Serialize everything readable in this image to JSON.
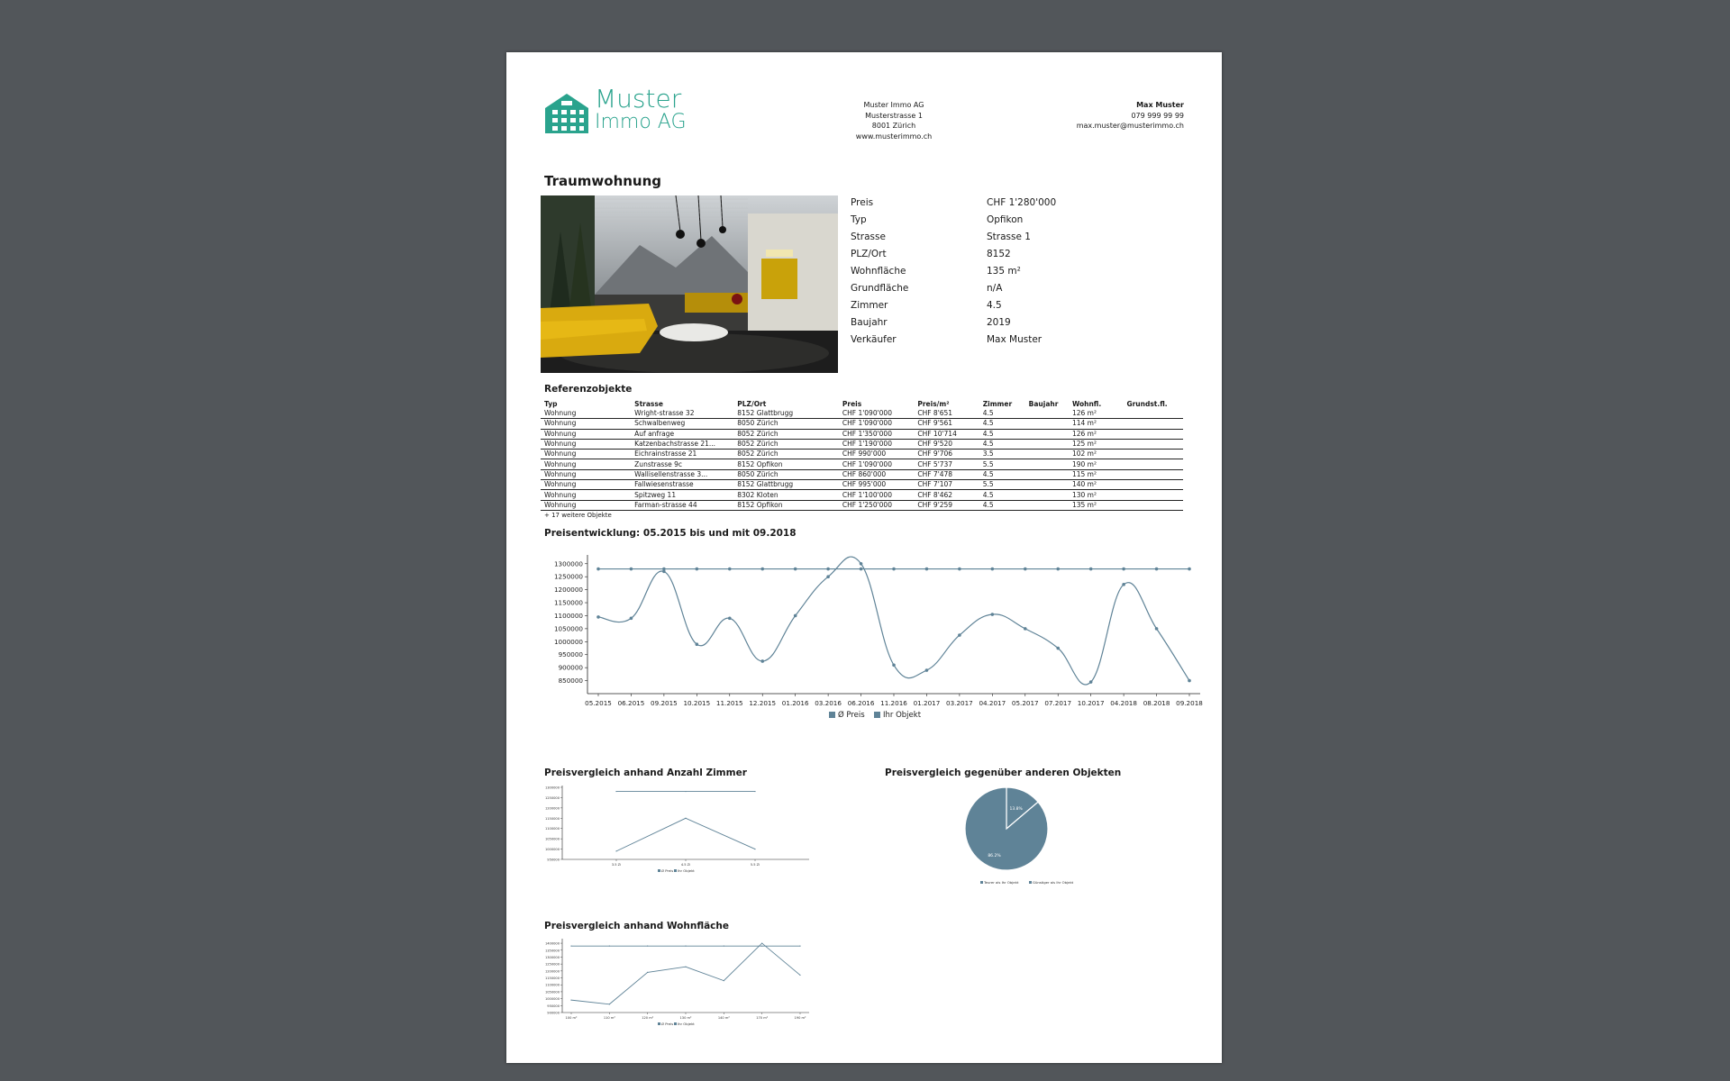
{
  "header": {
    "logo": {
      "line1": "Muster",
      "line2": "Immo AG"
    },
    "company": [
      "Muster Immo AG",
      "Musterstrasse 1",
      "8001 Zürich",
      "www.musterimmo.ch"
    ],
    "contact": {
      "name": "Max Muster",
      "phone": "079 999 99 99",
      "email": "max.muster@musterimmo.ch"
    }
  },
  "title": "Traumwohnung",
  "facts": [
    {
      "k": "Preis",
      "v": "CHF 1'280'000"
    },
    {
      "k": "Typ",
      "v": "Opfikon"
    },
    {
      "k": "Strasse",
      "v": "Strasse 1"
    },
    {
      "k": "PLZ/Ort",
      "v": "8152"
    },
    {
      "k": "Wohnfläche",
      "v": "135 m²"
    },
    {
      "k": "Grundfläche",
      "v": "n/A"
    },
    {
      "k": "Zimmer",
      "v": "4.5"
    },
    {
      "k": "Baujahr",
      "v": "2019"
    },
    {
      "k": "Verkäufer",
      "v": "Max Muster"
    }
  ],
  "references": {
    "title": "Referenzobjekte",
    "headers": [
      "Typ",
      "Strasse",
      "PLZ/Ort",
      "Preis",
      "Preis/m²",
      "Zimmer",
      "Baujahr",
      "Wohnfl.",
      "Grundst.fl."
    ],
    "rows": [
      [
        "Wohnung",
        "Wright-strasse 32",
        "8152 Glattbrugg",
        "CHF 1'090'000",
        "CHF 8'651",
        "4.5",
        "",
        "126 m²",
        ""
      ],
      [
        "Wohnung",
        "Schwalbenweg",
        "8050 Zürich",
        "CHF 1'090'000",
        "CHF 9'561",
        "4.5",
        "",
        "114 m²",
        ""
      ],
      [
        "Wohnung",
        "Auf anfrage",
        "8052 Zürich",
        "CHF 1'350'000",
        "CHF 10'714",
        "4.5",
        "",
        "126 m²",
        ""
      ],
      [
        "Wohnung",
        "Katzenbachstrasse 21...",
        "8052 Zürich",
        "CHF 1'190'000",
        "CHF 9'520",
        "4.5",
        "",
        "125 m²",
        ""
      ],
      [
        "Wohnung",
        "Eichrainstrasse 21",
        "8052 Zürich",
        "CHF 990'000",
        "CHF 9'706",
        "3.5",
        "",
        "102 m²",
        ""
      ],
      [
        "Wohnung",
        "Zunstrasse 9c",
        "8152 Opfikon",
        "CHF 1'090'000",
        "CHF 5'737",
        "5.5",
        "",
        "190 m²",
        ""
      ],
      [
        "Wohnung",
        "Wallisellenstrasse 3...",
        "8050 Zürich",
        "CHF 860'000",
        "CHF 7'478",
        "4.5",
        "",
        "115 m²",
        ""
      ],
      [
        "Wohnung",
        "Fallwiesenstrasse",
        "8152 Glattbrugg",
        "CHF 995'000",
        "CHF 7'107",
        "5.5",
        "",
        "140 m²",
        ""
      ],
      [
        "Wohnung",
        "Spitzweg 11",
        "8302 Kloten",
        "CHF 1'100'000",
        "CHF 8'462",
        "4.5",
        "",
        "130 m²",
        ""
      ],
      [
        "Wohnung",
        "Farman-strasse 44",
        "8152 Opfikon",
        "CHF 1'250'000",
        "CHF 9'259",
        "4.5",
        "",
        "135 m²",
        ""
      ]
    ],
    "more": "+ 17 weitere Objekte"
  },
  "chart_titles": {
    "main": "Preisentwicklung: 05.2015 bis und mit 09.2018",
    "rooms": "Preisvergleich anhand Anzahl Zimmer",
    "pie": "Preisvergleich gegenüber anderen Objekten",
    "area": "Preisvergleich anhand Wohnfläche"
  },
  "colors": {
    "series": "#5f8397",
    "accent": "#2aa38d"
  },
  "chart_data": [
    {
      "type": "line",
      "categories": [
        "05.2015",
        "06.2015",
        "09.2015",
        "10.2015",
        "11.2015",
        "12.2015",
        "01.2016",
        "03.2016",
        "06.2016",
        "11.2016",
        "01.2017",
        "03.2017",
        "04.2017",
        "05.2017",
        "07.2017",
        "10.2017",
        "04.2018",
        "08.2018",
        "09.2018"
      ],
      "ylim": [
        800000,
        1320000
      ],
      "yticks": [
        1300000,
        1250000,
        1200000,
        1150000,
        1100000,
        1050000,
        1000000,
        950000,
        900000,
        850000
      ],
      "series": [
        {
          "name": "Ø Preis",
          "values": [
            1095000,
            1090000,
            1270000,
            990000,
            1090000,
            925000,
            1100000,
            1250000,
            1300000,
            910000,
            890000,
            1025000,
            1105000,
            1050000,
            975000,
            845000,
            1220000,
            1050000,
            850000
          ]
        },
        {
          "name": "Ihr Objekt",
          "values": [
            1280000,
            1280000,
            1280000,
            1280000,
            1280000,
            1280000,
            1280000,
            1280000,
            1280000,
            1280000,
            1280000,
            1280000,
            1280000,
            1280000,
            1280000,
            1280000,
            1280000,
            1280000,
            1280000
          ]
        }
      ],
      "legend": "bottom"
    },
    {
      "type": "line",
      "categories": [
        "3.5 Zi",
        "4.5 Zi",
        "5.5 Zi"
      ],
      "series": [
        {
          "name": "Ø Preis",
          "values": [
            990000,
            1150000,
            1000000
          ]
        },
        {
          "name": "Ihr Objekt",
          "values": [
            1280000,
            1280000,
            1280000
          ]
        }
      ],
      "legend": "bottom"
    },
    {
      "type": "pie",
      "labels": [
        "Teurer als Ihr Objekt",
        "Günstiger als Ihr Objekt"
      ],
      "values": [
        13.8,
        86.2
      ],
      "slice_labels": [
        "13.8%",
        "86.2%"
      ],
      "legend": "bottom"
    },
    {
      "type": "line",
      "categories": [
        "100 m²",
        "110 m²",
        "120 m²",
        "130 m²",
        "140 m²",
        "170 m²",
        "190 m²"
      ],
      "series": [
        {
          "name": "Ø Preis",
          "values": [
            990000,
            960000,
            1190000,
            1230000,
            1130000,
            1400000,
            1170000
          ]
        },
        {
          "name": "Ihr Objekt",
          "values": [
            1380000,
            1380000,
            1380000,
            1380000,
            1380000,
            1380000,
            1380000
          ]
        }
      ],
      "legend": "bottom"
    }
  ]
}
